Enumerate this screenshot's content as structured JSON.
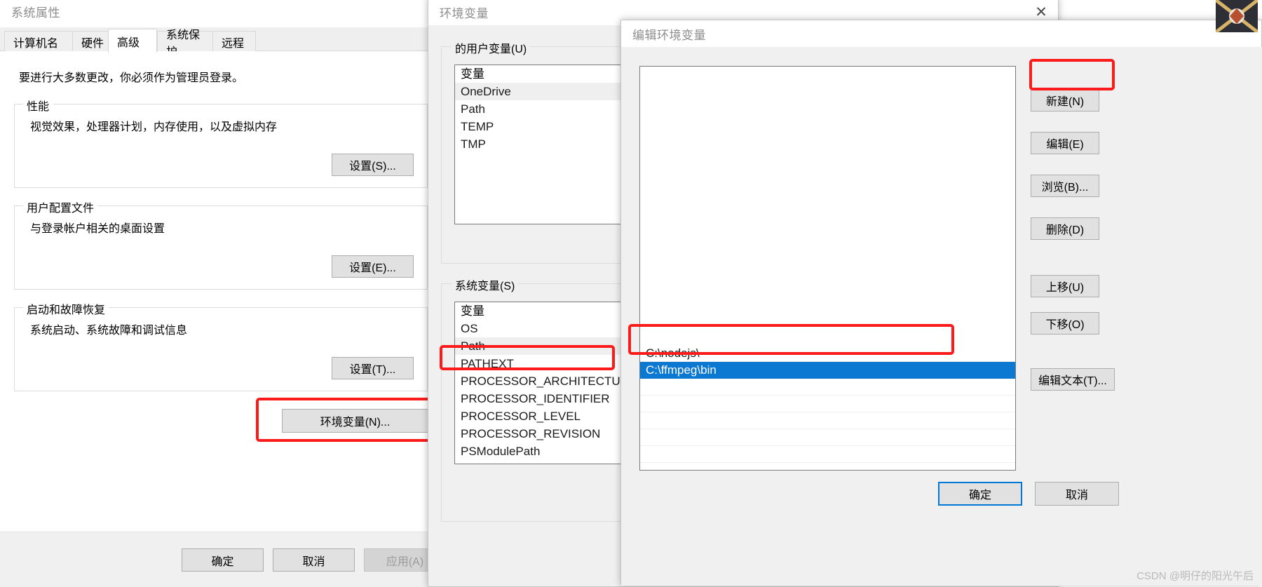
{
  "system_properties": {
    "title": "系统属性",
    "tabs": [
      {
        "label": "计算机名",
        "active": false
      },
      {
        "label": "硬件",
        "active": false
      },
      {
        "label": "高级",
        "active": true
      },
      {
        "label": "系统保护",
        "active": false
      },
      {
        "label": "远程",
        "active": false
      }
    ],
    "admin_notice": "要进行大多数更改，你必须作为管理员登录。",
    "groups": [
      {
        "title": "性能",
        "desc": "视觉效果，处理器计划，内存使用，以及虚拟内存",
        "button": "设置(S)..."
      },
      {
        "title": "用户配置文件",
        "desc": "与登录帐户相关的桌面设置",
        "button": "设置(E)..."
      },
      {
        "title": "启动和故障恢复",
        "desc": "系统启动、系统故障和调试信息",
        "button": "设置(T)..."
      }
    ],
    "env_button": "环境变量(N)...",
    "footer": {
      "ok": "确定",
      "cancel": "取消",
      "apply": "应用(A)"
    }
  },
  "environment_variables": {
    "title": "环境变量",
    "close_icon": "close-icon",
    "user_section_label": "的用户变量(U)",
    "user_table_header": "变量",
    "user_rows": [
      {
        "name": "OneDrive",
        "selected": true
      },
      {
        "name": "Path",
        "selected": false
      },
      {
        "name": "TEMP",
        "selected": false
      },
      {
        "name": "TMP",
        "selected": false
      }
    ],
    "system_section_label": "系统变量(S)",
    "system_table_header": "变量",
    "system_rows": [
      {
        "name": "OS",
        "selected": false
      },
      {
        "name": "Path",
        "selected": true
      },
      {
        "name": "PATHEXT",
        "selected": false
      },
      {
        "name": "PROCESSOR_ARCHITECTURE",
        "selected": false
      },
      {
        "name": "PROCESSOR_IDENTIFIER",
        "selected": false
      },
      {
        "name": "PROCESSOR_LEVEL",
        "selected": false
      },
      {
        "name": "PROCESSOR_REVISION",
        "selected": false
      },
      {
        "name": "PSModulePath",
        "selected": false
      }
    ]
  },
  "edit_environment_variable": {
    "title": "编辑环境变量",
    "rows": [
      {
        "value": "C:\\nodejs\\",
        "selected": false
      },
      {
        "value": "C:\\ffmpeg\\bin",
        "selected": true
      },
      {
        "value": "",
        "selected": false
      },
      {
        "value": "",
        "selected": false
      },
      {
        "value": "",
        "selected": false
      },
      {
        "value": "",
        "selected": false
      },
      {
        "value": "",
        "selected": false
      }
    ],
    "side_buttons": [
      {
        "label": "新建(N)",
        "name": "new-button",
        "highlighted": true
      },
      {
        "label": "编辑(E)",
        "name": "edit-button",
        "highlighted": false
      },
      {
        "label": "浏览(B)...",
        "name": "browse-button",
        "highlighted": false
      },
      {
        "label": "删除(D)",
        "name": "delete-button",
        "highlighted": false
      },
      {
        "label": "上移(U)",
        "name": "move-up-button",
        "highlighted": false
      },
      {
        "label": "下移(O)",
        "name": "move-down-button",
        "highlighted": false
      },
      {
        "label": "编辑文本(T)...",
        "name": "edit-text-button",
        "highlighted": false
      }
    ],
    "footer": {
      "ok": "确定",
      "cancel": "取消"
    }
  },
  "watermark": "CSDN @明仔的阳光午后",
  "colors": {
    "highlight_red": "#fc1b1b",
    "selection_blue": "#0b78d1",
    "accent": "#0078d7"
  }
}
